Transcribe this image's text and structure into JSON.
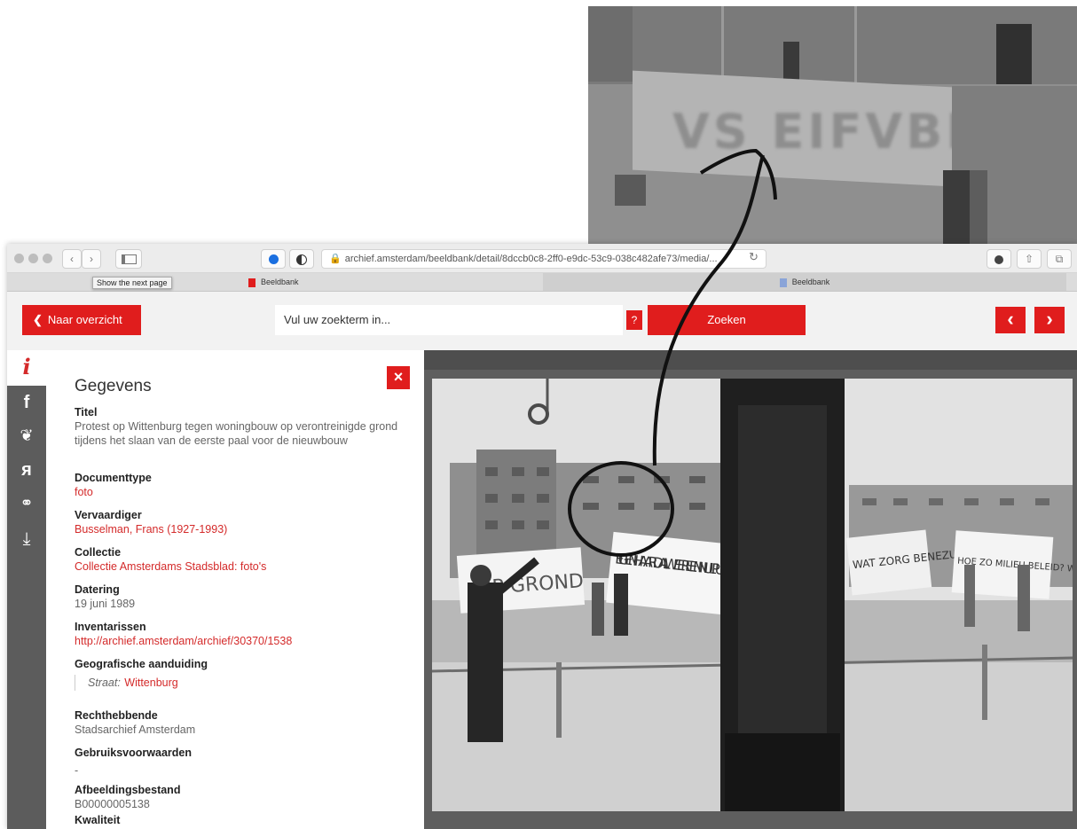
{
  "browser": {
    "url": "archief.amsterdam/beeldbank/detail/8dccb0c8-2ff0-e9dc-53c9-038c482afe73/media/...",
    "tooltip": "Show the next page",
    "tabs": [
      {
        "label": "Beeldbank"
      },
      {
        "label": "Beeldbank"
      }
    ]
  },
  "header": {
    "back_label": "Naar overzicht",
    "search_placeholder": "Vul uw zoekterm in...",
    "help_label": "?",
    "search_button": "Zoeken",
    "prev_label": "‹",
    "next_label": "›"
  },
  "info": {
    "title": "Gegevens",
    "close_label": "×",
    "fields": {
      "titel": {
        "label": "Titel",
        "value": "Protest op Wittenburg tegen woningbouw op verontreinigde grond tijdens het slaan van de eerste paal voor de nieuwbouw"
      },
      "documenttype": {
        "label": "Documenttype",
        "value": "foto"
      },
      "vervaardiger": {
        "label": "Vervaardiger",
        "value": "Busselman, Frans (1927-1993)"
      },
      "collectie": {
        "label": "Collectie",
        "value": "Collectie Amsterdams Stadsblad: foto's"
      },
      "datering": {
        "label": "Datering",
        "value": "19 juni 1989"
      },
      "inventarissen": {
        "label": "Inventarissen",
        "value": "http://archief.amsterdam/archief/30370/1538"
      },
      "geografisch": {
        "label": "Geografische aanduiding",
        "sublabel": "Straat:",
        "value": "Wittenburg"
      },
      "rechthebbende": {
        "label": "Rechthebbende",
        "value": "Stadsarchief Amsterdam"
      },
      "gebruiksvoorwaarden": {
        "label": "Gebruiksvoorwaarden",
        "value": "-"
      },
      "afbeeldingsbestand": {
        "label": "Afbeeldingsbestand",
        "value": "B00000005138"
      },
      "kwaliteit": {
        "label": "Kwaliteit"
      }
    }
  },
  "photo": {
    "banners": [
      "OP GROND",
      "EIGEN HAARD ALWEER EEN NULPUNT",
      "WAT ZORG BENEZUI",
      "HOE ZO MILIEU BELEID? Weth Ten Ham"
    ]
  },
  "zoom": {
    "banner_text": "VS EIFVBE"
  },
  "colors": {
    "accent": "#e01d1d",
    "link": "#d42a2a",
    "strip": "#5c5c5c",
    "viewer": "#5e5e5e"
  }
}
